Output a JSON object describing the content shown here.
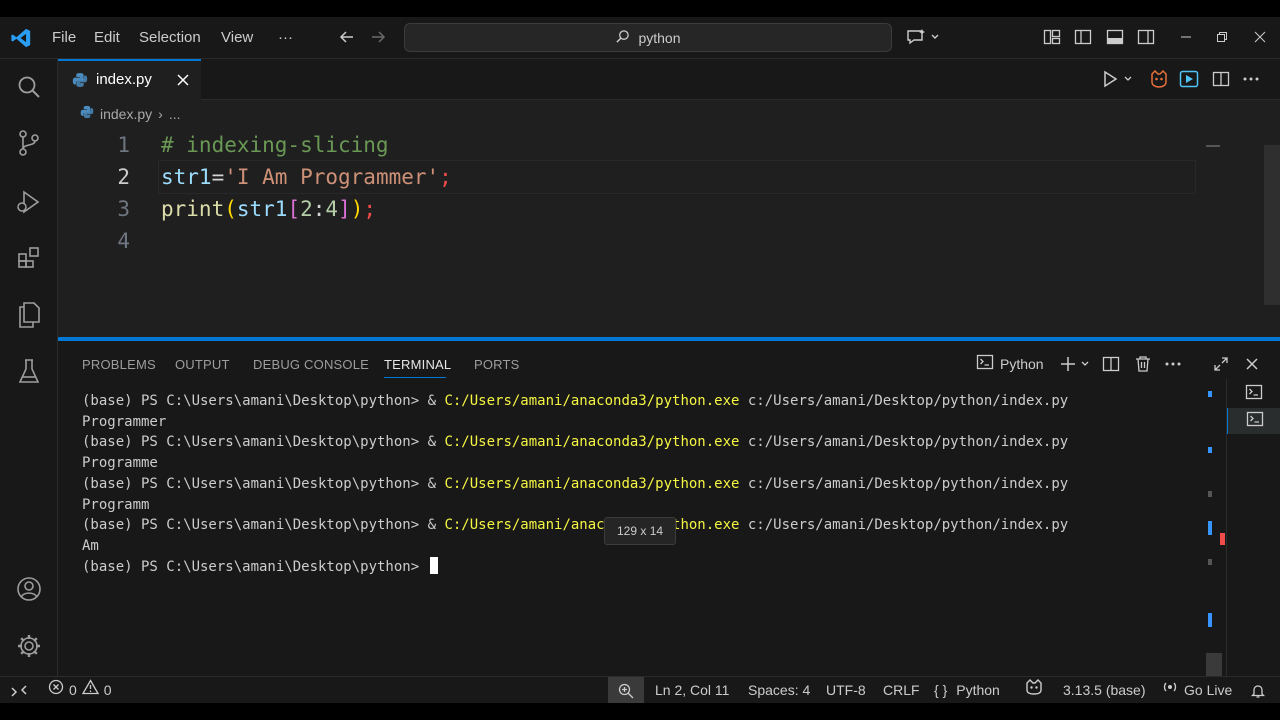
{
  "menu": {
    "file": "File",
    "edit": "Edit",
    "selection": "Selection",
    "view": "View",
    "more": "···"
  },
  "search": {
    "value": "python"
  },
  "tab": {
    "label": "index.py"
  },
  "breadcrumb": {
    "file": "index.py",
    "sep": "›",
    "rest": "..."
  },
  "editor": {
    "line_numbers": [
      "1",
      "2",
      "3",
      "4"
    ],
    "line1": {
      "comment": "# indexing-slicing"
    },
    "line2": {
      "var": "str1",
      "eq": "=",
      "str": "'I Am Programmer'",
      "semi": ";"
    },
    "line3": {
      "fn": "print",
      "p_open": "(",
      "var": "str1",
      "b_open": "[",
      "start": "2",
      "colon": ":",
      "end": "4",
      "b_close": "]",
      "p_close": ")",
      "semi": ";"
    }
  },
  "panel": {
    "tabs": [
      "PROBLEMS",
      "OUTPUT",
      "DEBUG CONSOLE",
      "TERMINAL",
      "PORTS"
    ],
    "active_tab": "TERMINAL",
    "terminal_profile": "Python",
    "tooltip": "129 x 14"
  },
  "terminal": {
    "prompt": "(base) PS C:\\Users\\amani\\Desktop\\python> ",
    "amp": "& ",
    "exe": "C:/Users/amani/anaconda3/python.exe",
    "script": " c:/Users/amani/Desktop/python/index.py",
    "outputs": [
      "Programmer",
      "Programme",
      "Programm",
      "Am"
    ]
  },
  "status": {
    "errors": "0",
    "warnings": "0",
    "position": "Ln 2, Col 11",
    "spaces": "Spaces: 4",
    "encoding": "UTF-8",
    "eol": "CRLF",
    "braces": "{ }",
    "language": "Python",
    "interpreter": "3.13.5 (base)",
    "go_live": "Go Live"
  },
  "colors": {
    "accent": "#0078d4",
    "terminal_exe": "#f5f543",
    "editor_bg": "#1f1f1f",
    "panel_bg": "#181818"
  },
  "icons": [
    "vscode-logo-icon",
    "search-icon",
    "source-control-icon",
    "run-debug-icon",
    "extensions-icon",
    "explorer-icon",
    "testing-icon",
    "account-icon",
    "settings-gear-icon",
    "python-file-icon",
    "close-icon",
    "run-icon",
    "copilot-icon",
    "terminal-icon",
    "trash-icon",
    "maximize-icon",
    "bell-icon"
  ]
}
